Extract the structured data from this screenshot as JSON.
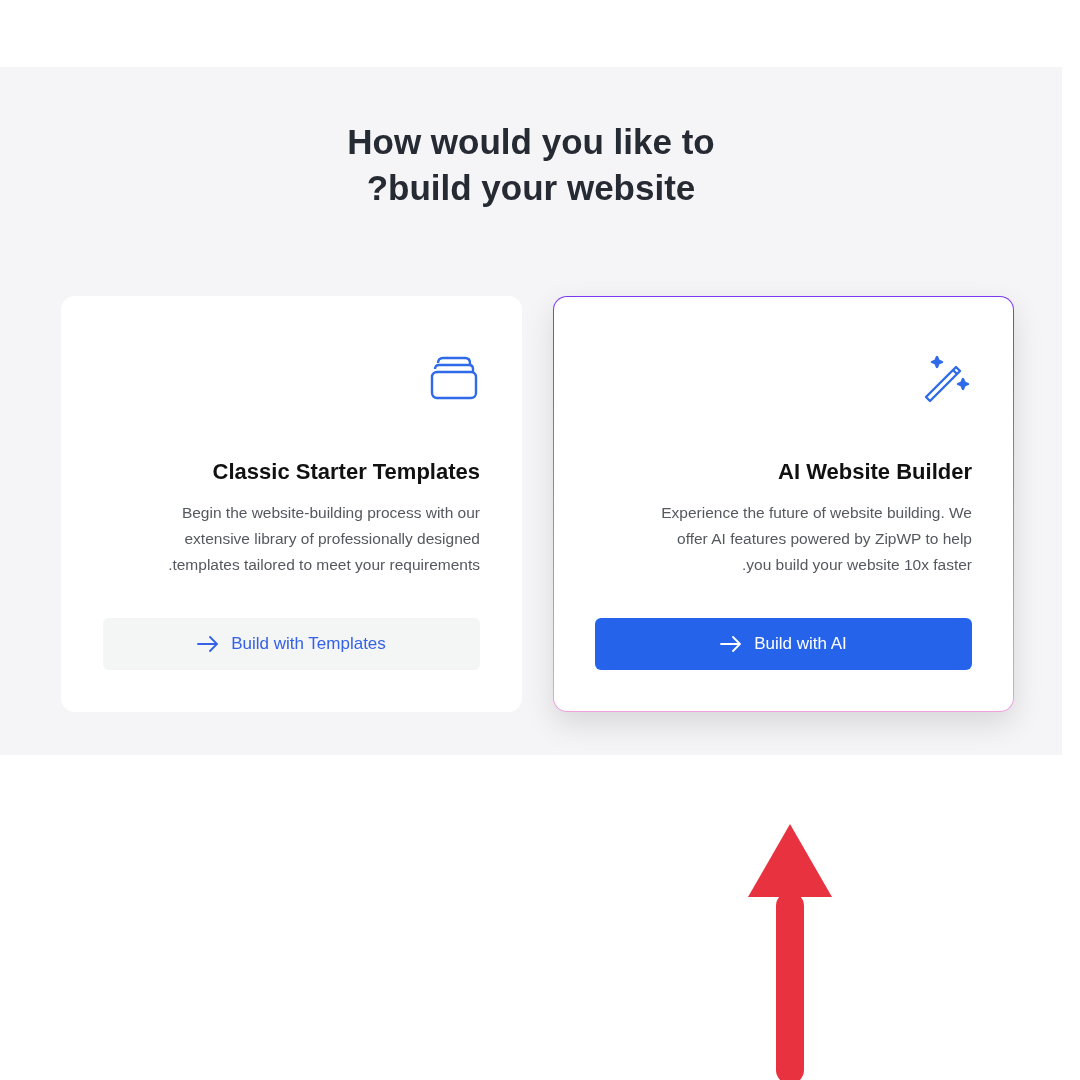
{
  "heading": {
    "lines": [
      "How would you like to",
      "?build your website"
    ]
  },
  "cards": [
    {
      "kind": "stack",
      "title": "Classic Starter Templates",
      "selected": false,
      "description": [
        "Begin the website-building process with our",
        "extensive library of professionally designed",
        ".templates tailored to meet your requirements"
      ],
      "button": "Build with Templates"
    },
    {
      "kind": "wand",
      "title": "AI Website Builder",
      "selected": true,
      "description": [
        "Experience the future of website building. We",
        "offer AI features powered by ZipWP to help",
        ".you build your website 10x faster"
      ],
      "button": "Build with AI"
    }
  ],
  "annotation": {
    "kind": "arrow"
  }
}
